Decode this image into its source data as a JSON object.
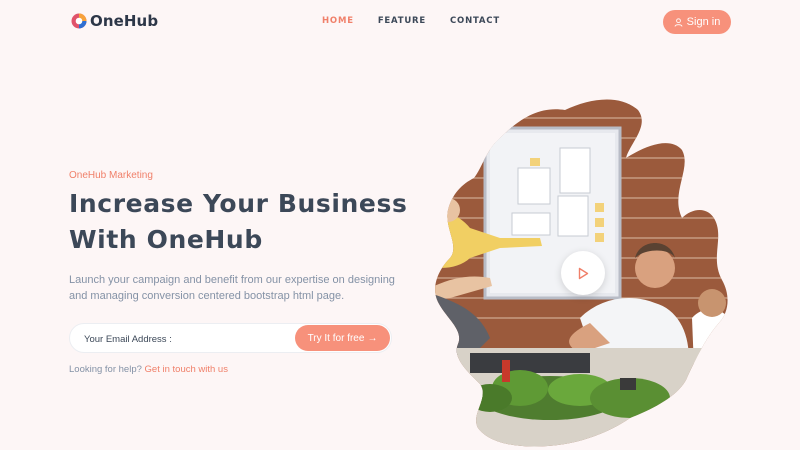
{
  "brand": {
    "name": "OneHub"
  },
  "nav": {
    "items": [
      {
        "label": "HOME"
      },
      {
        "label": "FEATURE"
      },
      {
        "label": "CONTACT"
      }
    ]
  },
  "header": {
    "signin_label": "Sign in"
  },
  "hero": {
    "eyebrow": "OneHub Marketing",
    "title_line1": "Increase Your Business",
    "title_line2": "With OneHub",
    "lead": "Launch your campaign and benefit from our expertise on designing and managing conversion centered bootstrap html page.",
    "email_placeholder": "Your Email Address :",
    "cta_label": "Try It for free",
    "help_text": "Looking for help?",
    "help_link": "Get in touch with us"
  },
  "icons": {
    "logo": "onehub-logo-icon",
    "signin": "user-icon",
    "cta": "arrow-right-icon",
    "play": "play-icon"
  },
  "colors": {
    "accent": "#f7917b",
    "accent_text": "#f0806a",
    "background": "#fdf6f6",
    "heading": "#3c4858",
    "muted": "#8492a6"
  }
}
